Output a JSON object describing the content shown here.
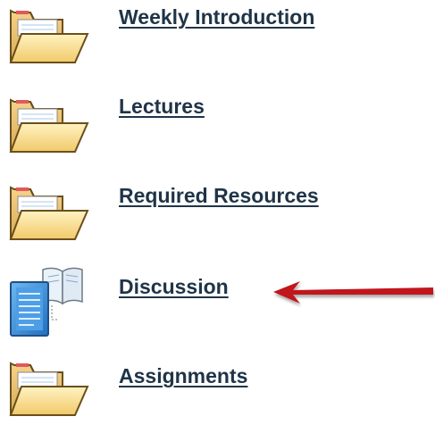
{
  "items": [
    {
      "label": "Weekly Introduction",
      "icon": "folder-icon"
    },
    {
      "label": "Lectures",
      "icon": "folder-icon"
    },
    {
      "label": "Required Resources",
      "icon": "folder-icon"
    },
    {
      "label": "Discussion",
      "icon": "discussion-board-icon"
    },
    {
      "label": "Assignments",
      "icon": "folder-icon"
    }
  ],
  "annotation": {
    "arrow_color": "#c0161d",
    "points_to": "Discussion"
  },
  "colors": {
    "link": "#1f3448",
    "folder_fill": "#f5d67d",
    "folder_edge": "#6a4f1b",
    "document_blue": "#2b8cdf"
  }
}
